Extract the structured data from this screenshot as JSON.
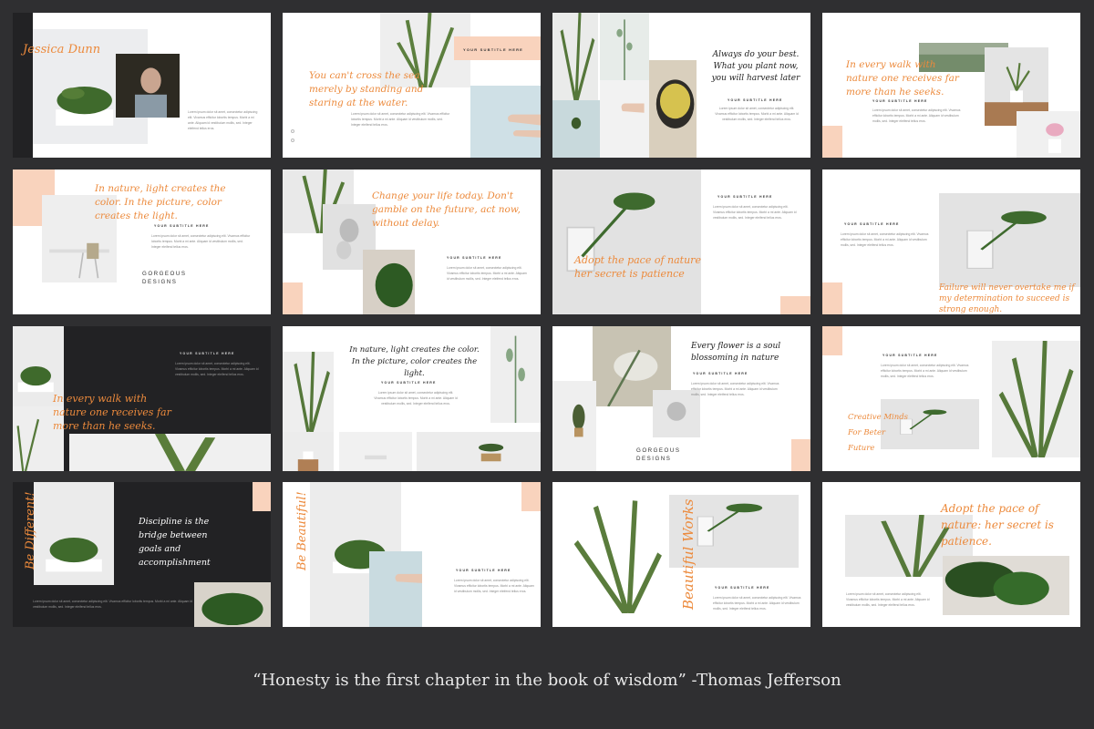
{
  "colors": {
    "accent": "#ec8a3c",
    "peach": "#f9d3bd",
    "dark": "#222224",
    "background": "#2f2f31"
  },
  "lorem": "Lorem ipsum dolor sit amet, consectetur adipiscing elit. Vivamus efficitur lobortis tempus. Morbi a mi ante. Aliquam id vestibulum mollis, sed. Integer eleifend tellus eros.",
  "subtitle": "YOUR SUBTITLE HERE",
  "gorgeous": "GORGEOUS DESIGNS",
  "slides": {
    "s1": {
      "title": "Jessica Dunn"
    },
    "s2": {
      "title": "You can't cross the sea merely by standing and staring at the water."
    },
    "s3": {
      "title": "Always do your best. What you plant now, you will harvest later"
    },
    "s4": {
      "title": "In every walk with nature one receives far more than he seeks."
    },
    "s5": {
      "title": "In nature, light creates the color. In the picture, color creates the light."
    },
    "s6": {
      "title": "Change your life today. Don't gamble on the future, act now, without delay."
    },
    "s7": {
      "title": "Adopt the pace of nature her secret is patience"
    },
    "s8": {
      "title": "Failure will never overtake me if my determination to succeed is strong enough."
    },
    "s9": {
      "title": "In every walk with nature one receives far more than he seeks."
    },
    "s10": {
      "title": "In nature, light creates the color. In the picture, color creates the light."
    },
    "s11": {
      "title": "Every flower is a soul blossoming in nature"
    },
    "s12": {
      "title": "Creative Minds For Beter Future"
    },
    "s13": {
      "title": "Be Different!",
      "quote": "Discipline is the bridge between goals and accomplishment"
    },
    "s14": {
      "title": "Be Beautiful!"
    },
    "s15": {
      "title": "Beautiful Works"
    },
    "s16": {
      "title": "Adopt the pace of nature: her secret is patience."
    }
  },
  "footer_quote": "“Honesty is the first chapter in the book of wisdom”   -Thomas Jefferson"
}
